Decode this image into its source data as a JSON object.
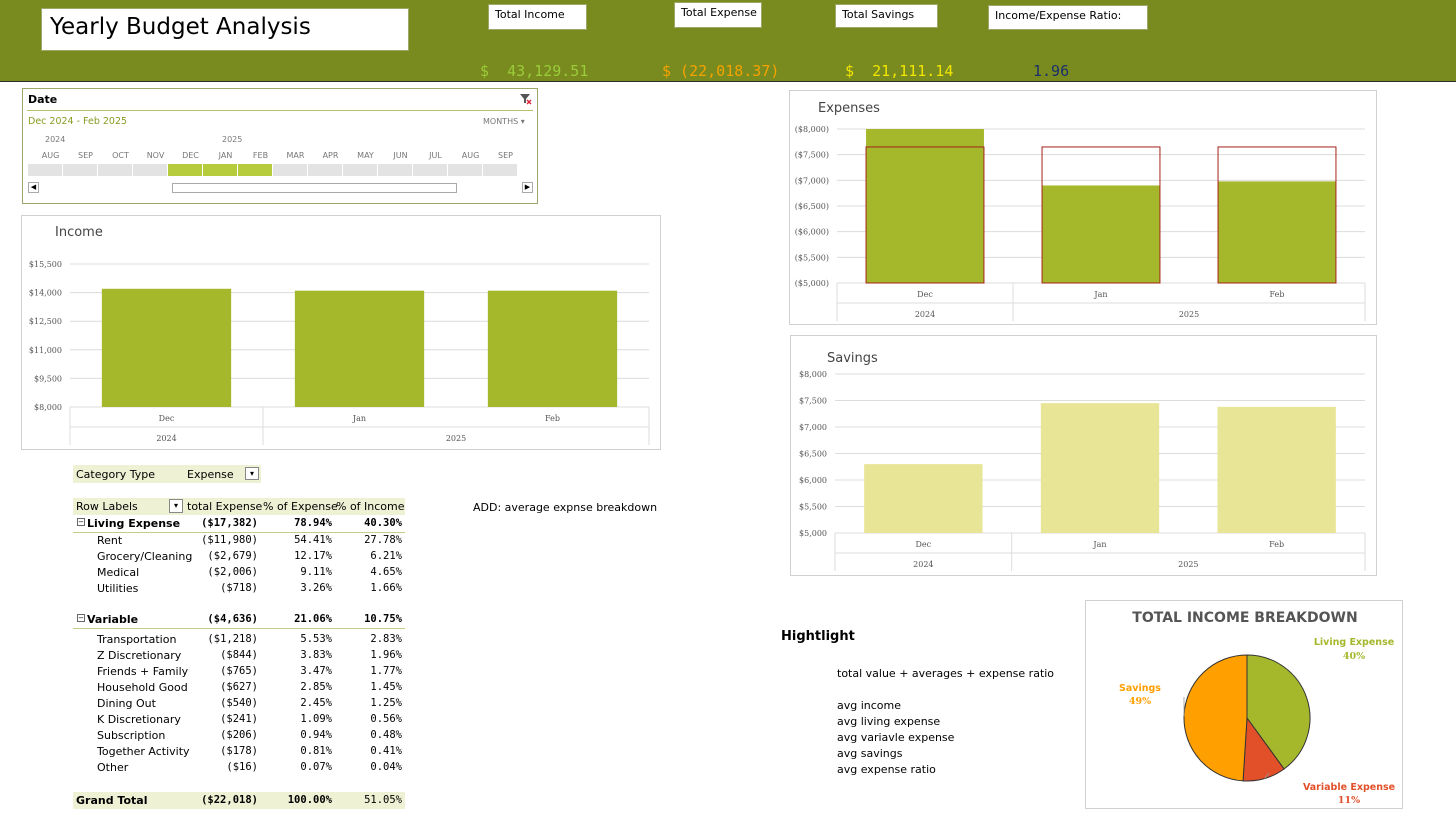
{
  "header": {
    "title": "Yearly Budget Analysis",
    "kpis": [
      {
        "label": "Total Income",
        "value": "$  43,129.51",
        "color": "#9bcc3a"
      },
      {
        "label": "Total Expense",
        "value": "$ (22,018.37)",
        "color": "#f5a300"
      },
      {
        "label": "Total Savings",
        "value": "$  21,111.14",
        "color": "#f2e500"
      },
      {
        "label": "Income/Expense Ratio:",
        "value": "1.96",
        "color": "#1a2f6b"
      }
    ]
  },
  "timeline": {
    "title": "Date",
    "range": "Dec 2024 - Feb 2025",
    "level": "MONTHS",
    "years": [
      "2024",
      "2025"
    ],
    "months": [
      "AUG",
      "SEP",
      "OCT",
      "NOV",
      "DEC",
      "JAN",
      "FEB",
      "MAR",
      "APR",
      "MAY",
      "JUN",
      "JUL",
      "AUG",
      "SEP"
    ],
    "selected": [
      4,
      5,
      6
    ]
  },
  "income_chart": {
    "title": "Income",
    "type": "bar",
    "categories": [
      "Dec",
      "Jan",
      "Feb"
    ],
    "years": [
      {
        "label": "2024",
        "span": 1
      },
      {
        "label": "2025",
        "span": 2
      }
    ],
    "values": [
      14200,
      14100,
      14100
    ],
    "ylim": [
      8000,
      15500
    ],
    "ticks": [
      "$15,500",
      "$14,000",
      "$12,500",
      "$11,000",
      "$9,500",
      "$8,000"
    ],
    "color": "#a5b82b"
  },
  "expenses_chart": {
    "title": "Expenses",
    "type": "bar",
    "categories": [
      "Dec",
      "Jan",
      "Feb"
    ],
    "years": [
      {
        "label": "2024",
        "span": 1
      },
      {
        "label": "2025",
        "span": 2
      }
    ],
    "values": [
      -8000,
      -6900,
      -6980
    ],
    "target": [
      -7650,
      -7650,
      -7650
    ],
    "ylim": [
      -5000,
      -8000
    ],
    "ticks": [
      "($8,000)",
      "($7,500)",
      "($7,000)",
      "($6,500)",
      "($6,000)",
      "($5,500)",
      "($5,000)"
    ],
    "color": "#a5b82b",
    "target_color": "#a3231a"
  },
  "savings_chart": {
    "title": "Savings",
    "type": "bar",
    "categories": [
      "Dec",
      "Jan",
      "Feb"
    ],
    "years": [
      {
        "label": "2024",
        "span": 1
      },
      {
        "label": "2025",
        "span": 2
      }
    ],
    "values": [
      6300,
      7450,
      7380
    ],
    "ylim": [
      5000,
      8000
    ],
    "ticks": [
      "$8,000",
      "$7,500",
      "$7,000",
      "$6,500",
      "$6,000",
      "$5,500",
      "$5,000"
    ],
    "color": "#e8e597"
  },
  "pie_chart": {
    "title": "TOTAL INCOME BREAKDOWN",
    "type": "pie",
    "slices": [
      {
        "label": "Living Expense",
        "pct": "40%",
        "value": 40,
        "color": "#a5b82b"
      },
      {
        "label": "Variable Expense",
        "pct": "11%",
        "value": 11,
        "color": "#e2502a"
      },
      {
        "label": "Savings",
        "pct": "49%",
        "value": 49,
        "color": "#ff9f00"
      }
    ]
  },
  "pivot": {
    "filter_label": "Category Type",
    "filter_value": "Expense",
    "headers": [
      "Row Labels",
      "total Expense",
      "% of Expense",
      "% of Income"
    ],
    "groups": [
      {
        "name": "Living Expense",
        "total": "($17,382)",
        "pe": "78.94%",
        "pi": "40.30%",
        "rows": [
          {
            "name": "Rent",
            "total": "($11,980)",
            "pe": "54.41%",
            "pi": "27.78%"
          },
          {
            "name": "Grocery/Cleaning",
            "total": "($2,679)",
            "pe": "12.17%",
            "pi": "6.21%"
          },
          {
            "name": "Medical",
            "total": "($2,006)",
            "pe": "9.11%",
            "pi": "4.65%"
          },
          {
            "name": "Utilities",
            "total": "($718)",
            "pe": "3.26%",
            "pi": "1.66%"
          }
        ]
      },
      {
        "name": "Variable",
        "total": "($4,636)",
        "pe": "21.06%",
        "pi": "10.75%",
        "rows": [
          {
            "name": "Transportation",
            "total": "($1,218)",
            "pe": "5.53%",
            "pi": "2.83%"
          },
          {
            "name": "Z Discretionary",
            "total": "($844)",
            "pe": "3.83%",
            "pi": "1.96%"
          },
          {
            "name": "Friends + Family",
            "total": "($765)",
            "pe": "3.47%",
            "pi": "1.77%"
          },
          {
            "name": "Household Good",
            "total": "($627)",
            "pe": "2.85%",
            "pi": "1.45%"
          },
          {
            "name": "Dining Out",
            "total": "($540)",
            "pe": "2.45%",
            "pi": "1.25%"
          },
          {
            "name": "K Discretionary",
            "total": "($241)",
            "pe": "1.09%",
            "pi": "0.56%"
          },
          {
            "name": "Subscription",
            "total": "($206)",
            "pe": "0.94%",
            "pi": "0.48%"
          },
          {
            "name": "Together Activity",
            "total": "($178)",
            "pe": "0.81%",
            "pi": "0.41%"
          },
          {
            "name": "Other",
            "total": "($16)",
            "pe": "0.07%",
            "pi": "0.04%"
          }
        ]
      }
    ],
    "grand_total": {
      "name": "Grand Total",
      "total": "($22,018)",
      "pe": "100.00%",
      "pi": "51.05%"
    }
  },
  "notes": {
    "add_note": "ADD: average expnse breakdown",
    "highlight_title": "Hightlight",
    "highlight_items": [
      "total value + averages + expense ratio",
      "",
      "avg income",
      "avg living expense",
      "avg variavle expense",
      "avg savings",
      "avg expense ratio"
    ]
  }
}
